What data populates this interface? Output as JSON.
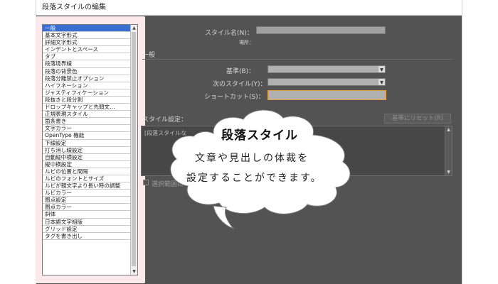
{
  "window": {
    "title": "段落スタイルの編集"
  },
  "category_list": {
    "items": [
      "一般",
      "基本文字形式",
      "詳細文字形式",
      "インデントとスペース",
      "タブ",
      "段落境界線",
      "段落の背景色",
      "段落分離禁止オプション",
      "ハイフネーション",
      "ジャスティフィケーション",
      "段抜きと段分割",
      "ドロップキャップと先頭文…",
      "正規表現スタイル",
      "箇条書き",
      "文字カラー",
      "OpenType 機能",
      "下線設定",
      "打ち消し線設定",
      "自動縦中横設定",
      "縦中横設定",
      "ルビの位置と間隔",
      "ルビのフォントとサイズ",
      "ルビが親文字より長い時の調整",
      "ルビカラー",
      "圏点設定",
      "圏点カラー",
      "斜体",
      "日本語文字組版",
      "グリッド設定",
      "タグを書き出し"
    ],
    "selected_index": 0
  },
  "form": {
    "style_name_label": "スタイル名(N)：",
    "location_label": "場所：",
    "section_general": "一般",
    "based_on_label": "基準(B)：",
    "next_style_label": "次のスタイル(Y)：",
    "shortcut_label": "ショートカット(S)：",
    "style_settings_label": "スタイル設定：",
    "reset_button": "基準にリセット(R)",
    "settings_text": "[段落スタイルな",
    "apply_selection_label": "選択範囲に"
  },
  "callout": {
    "title": "段落スタイル",
    "line1": "文章や見出しの体裁を",
    "line2": "設定することができます。"
  },
  "colors": {
    "selection": "#3a6fd1",
    "shortcut_focus": "#e89a3a",
    "panel": "#535353"
  }
}
